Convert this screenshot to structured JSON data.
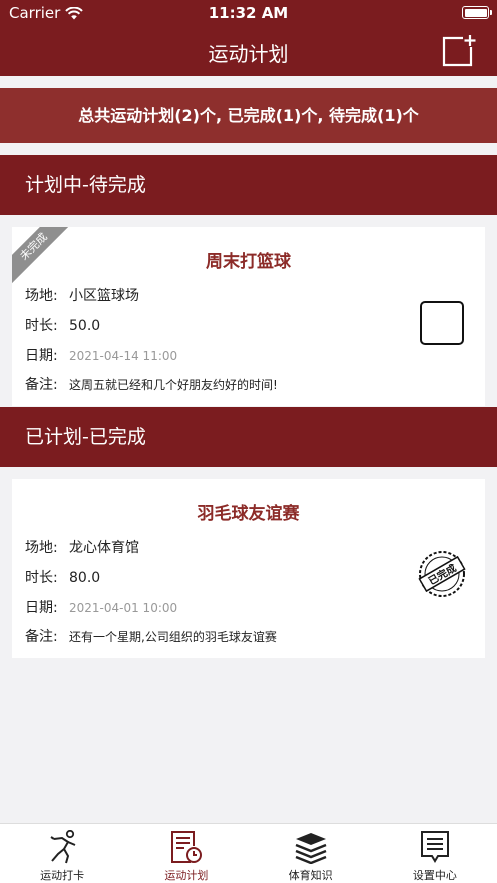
{
  "status": {
    "carrier": "Carrier",
    "time": "11:32 AM"
  },
  "nav": {
    "title": "运动计划",
    "add_icon": "add-note-icon"
  },
  "summary": "总共运动计划(2)个, 已完成(1)个, 待完成(1)个",
  "pending": {
    "header": "计划中-待完成",
    "card": {
      "ribbon": "未完成",
      "title": "周末打篮球",
      "venue_label": "场地:",
      "venue": "小区篮球场",
      "duration_label": "时长:",
      "duration": "50.0",
      "date_label": "日期:",
      "date": "2021-04-14 11:00",
      "note_label": "备注:",
      "note": "这周五就已经和几个好朋友约好的时间!"
    }
  },
  "done": {
    "header": "已计划-已完成",
    "card": {
      "title": "羽毛球友谊赛",
      "venue_label": "场地:",
      "venue": "龙心体育馆",
      "duration_label": "时长:",
      "duration": "80.0",
      "date_label": "日期:",
      "date": "2021-04-01 10:00",
      "note_label": "备注:",
      "note": "还有一个星期,公司组织的羽毛球友谊赛",
      "stamp": "已完成"
    }
  },
  "tabs": [
    {
      "label": "运动打卡",
      "icon": "exercise-icon",
      "active": false
    },
    {
      "label": "运动计划",
      "icon": "plan-calendar-icon",
      "active": true
    },
    {
      "label": "体育知识",
      "icon": "books-icon",
      "active": false
    },
    {
      "label": "设置中心",
      "icon": "settings-doc-icon",
      "active": false
    }
  ],
  "colors": {
    "primary": "#7b1c1f",
    "summary_bg": "#8e2f2d",
    "title_text": "#8c2b28"
  }
}
